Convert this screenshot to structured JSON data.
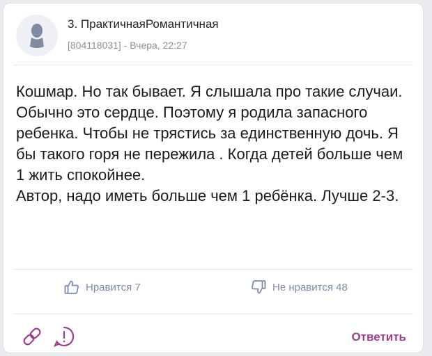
{
  "comment": {
    "author": "3. ПрактичнаяРомантичная",
    "meta_id": "[804118031]",
    "meta_separator": " - ",
    "meta_time": "Вчера, 22:27",
    "avatar_icon": "user-silhouette-icon",
    "paragraphs": [
      "Кошмар. Но так бывает. Я слышала про такие случаи. Обычно это сердце. Поэтому я родила запасного ребенка. Чтобы не трястись за единственную дочь. Я бы такого горя не пережила . Когда детей больше чем 1 жить спокойнее.",
      "Автор, надо иметь больше чем 1 ребёнка. Лучше 2-3."
    ]
  },
  "reactions": {
    "like_label": "Нравится 7",
    "like_icon": "thumbs-up-icon",
    "dislike_label": "Не нравится 48",
    "dislike_icon": "thumbs-down-icon"
  },
  "footer": {
    "link_icon": "link-icon",
    "report_icon": "exclamation-circle-icon",
    "reply_label": "Ответить"
  },
  "colors": {
    "accent": "#a23b8c",
    "reaction": "#7d8cb3",
    "meta": "#8a8f99"
  }
}
